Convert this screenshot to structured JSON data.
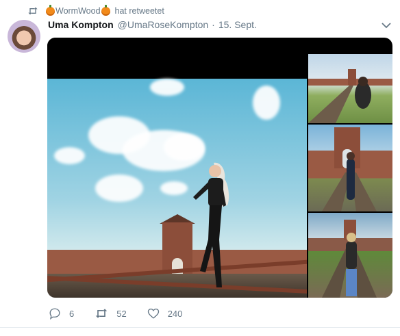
{
  "retweet": {
    "name": "WormWood",
    "suffix": "hat retweetet"
  },
  "tweet": {
    "display_name": "Uma Kompton",
    "handle": "@UmaRoseKompton",
    "separator": "·",
    "time": "15. Sept."
  },
  "actions": {
    "reply_count": "6",
    "retweet_count": "52",
    "like_count": "240"
  },
  "colors": {
    "secondary_text": "#657786",
    "primary_text": "#14171a",
    "divider": "#e6ecf0"
  }
}
